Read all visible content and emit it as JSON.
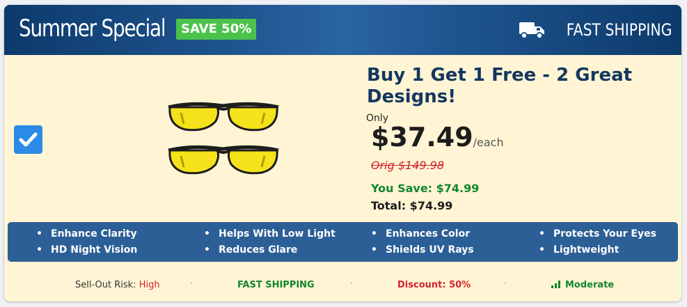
{
  "header": {
    "title": "Summer Special",
    "badge": "SAVE 50%",
    "shipping_label": "FAST SHIPPING"
  },
  "offer": {
    "headline": "Buy 1 Get 1 Free - 2 Great Designs!",
    "only_label": "Only",
    "price": "$37.49",
    "per_unit": "/each",
    "original_price": "Orig $149.98",
    "you_save": "You Save: $74.99",
    "total": "Total: $74.99",
    "selected": true
  },
  "features": [
    "Enhance Clarity",
    "HD Night Vision",
    "Helps With Low Light",
    "Reduces Glare",
    "Enhances Color",
    "Shields UV Rays",
    "Protects Your Eyes",
    "Lightweight"
  ],
  "footer": {
    "risk_label": "Sell-Out Risk:",
    "risk_value": "High",
    "shipping": "FAST SHIPPING",
    "discount": "Discount: 50%",
    "stock": "Moderate",
    "separator": "·"
  },
  "colors": {
    "header_blue": "#1f5690",
    "badge_green": "#4cc24c",
    "panel_cream": "#fff5d4",
    "headline_navy": "#14375f",
    "save_green": "#14862e",
    "alert_red": "#d2232a"
  },
  "icons": [
    "truck-icon",
    "checkmark-icon",
    "signal-bars-icon"
  ]
}
